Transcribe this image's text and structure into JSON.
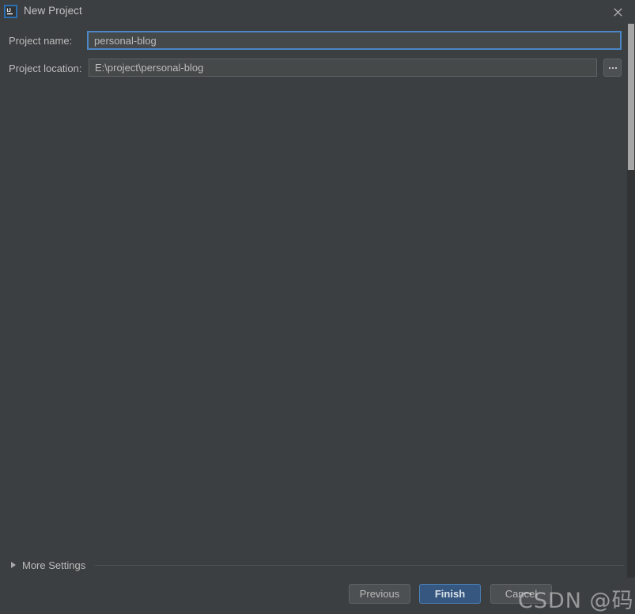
{
  "window": {
    "title": "New Project",
    "app_icon": "intellij-idea-icon",
    "close_icon": "close-icon"
  },
  "form": {
    "project_name": {
      "label": "Project name:",
      "value": "personal-blog",
      "placeholder": ""
    },
    "project_location": {
      "label": "Project location:",
      "value": "E:\\project\\personal-blog",
      "placeholder": "",
      "browse_label": "...",
      "browse_icon": "ellipsis-icon"
    }
  },
  "more_settings": {
    "label": "More Settings",
    "expander_icon": "chevron-right-icon",
    "expanded": false
  },
  "footer": {
    "previous_label": "Previous",
    "finish_label": "Finish",
    "cancel_label": "Cancel"
  },
  "watermark": {
    "text": "CSDN @码上客"
  },
  "colors": {
    "background": "#3c3f41",
    "input_background": "#45494a",
    "focus_border": "#4b87c6",
    "accent_button": "#365880",
    "text": "#bbbbbb"
  }
}
